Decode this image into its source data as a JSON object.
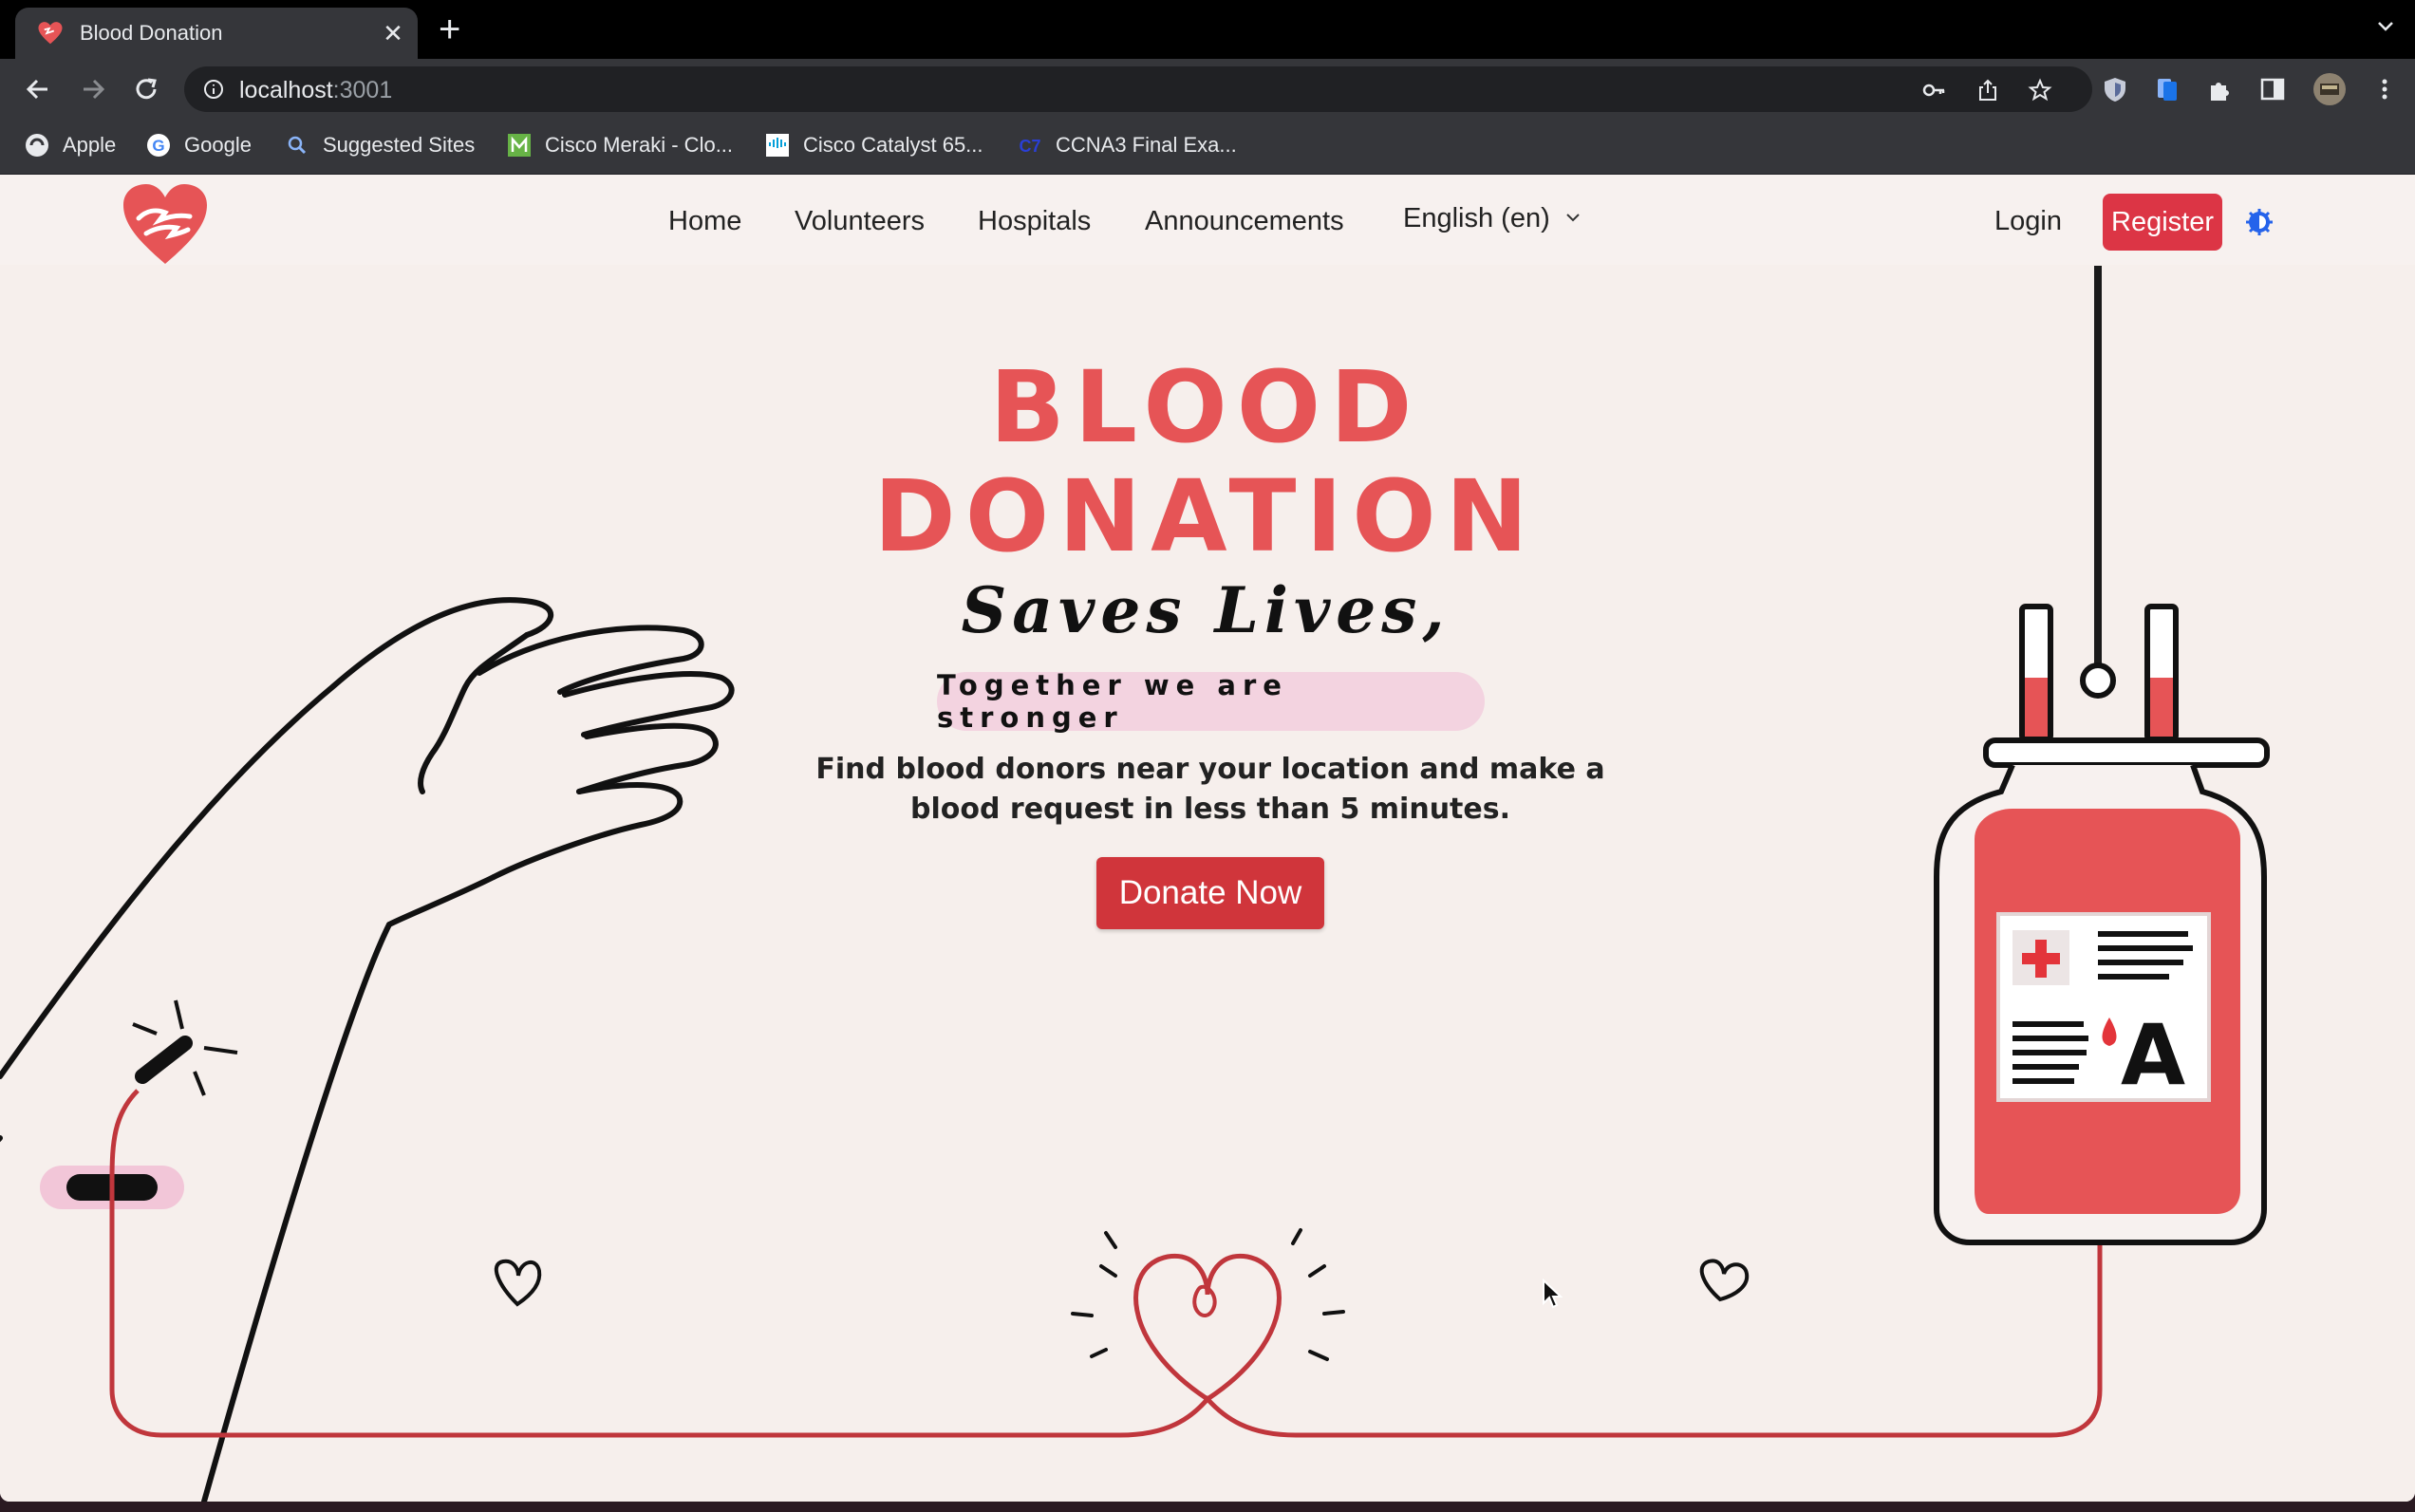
{
  "browser": {
    "tab_title": "Blood Donation",
    "tab_close": "✕",
    "new_tab": "+",
    "url_host": "localhost",
    "url_port": ":3001",
    "bookmarks": [
      {
        "label": "Apple",
        "icon": "apple-icon"
      },
      {
        "label": "Google",
        "icon": "google-icon"
      },
      {
        "label": "Suggested Sites",
        "icon": "search-icon"
      },
      {
        "label": "Cisco Meraki - Clo...",
        "icon": "meraki-icon"
      },
      {
        "label": "Cisco Catalyst 65...",
        "icon": "cisco-icon"
      },
      {
        "label": "CCNA3 Final Exa...",
        "icon": "ccna-icon"
      }
    ]
  },
  "nav": {
    "links": [
      "Home",
      "Volunteers",
      "Hospitals",
      "Announcements"
    ],
    "language": "English (en)",
    "login": "Login",
    "register": "Register"
  },
  "hero": {
    "title_line1": "BLOOD",
    "title_line2": "DONATION",
    "subtitle": "Saves Lives,",
    "tagline": "Together we are stronger",
    "description": "Find blood donors near your location and make a blood request in less than 5 minutes.",
    "cta": "Donate Now",
    "blood_type": "A"
  },
  "colors": {
    "brand_red": "#e65456",
    "button_red": "#dc3545",
    "pill_pink": "#f3d3e0",
    "background": "#f6efec"
  }
}
